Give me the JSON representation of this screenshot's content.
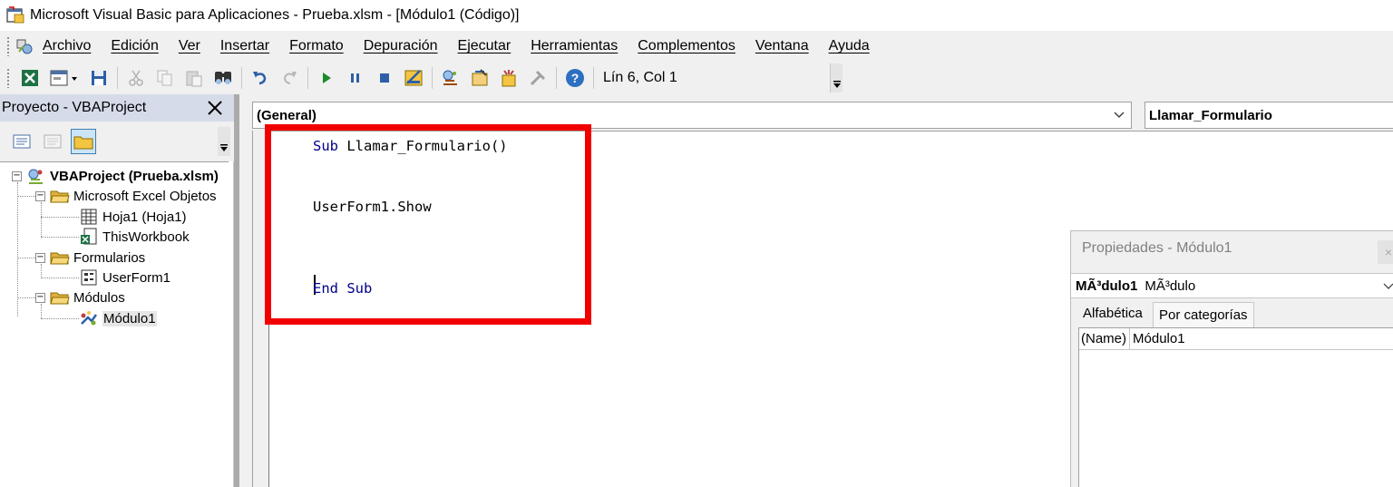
{
  "window": {
    "title": "Microsoft Visual Basic para Aplicaciones - Prueba.xlsm - [Módulo1 (Código)]",
    "icon": "vba-window-icon"
  },
  "menu": {
    "items": [
      "Archivo",
      "Edición",
      "Ver",
      "Insertar",
      "Formato",
      "Depuración",
      "Ejecutar",
      "Herramientas",
      "Complementos",
      "Ventana",
      "Ayuda"
    ]
  },
  "toolbar": {
    "position_label": "Lín 6, Col 1",
    "icons": [
      "excel-icon",
      "insert-userform-icon",
      "save-icon",
      "cut-icon",
      "copy-icon",
      "paste-icon",
      "find-icon",
      "undo-icon",
      "redo-icon",
      "run-icon",
      "break-icon",
      "reset-icon",
      "design-mode-icon",
      "project-explorer-icon",
      "properties-icon",
      "object-browser-icon",
      "toolbox-icon",
      "help-icon"
    ]
  },
  "project_panel": {
    "title": "Proyecto - VBAProject",
    "close": "✕",
    "tree": {
      "root": "VBAProject (Prueba.xlsm)",
      "excel_objects": "Microsoft Excel Objetos",
      "sheet1": "Hoja1 (Hoja1)",
      "workbook": "ThisWorkbook",
      "forms": "Formularios",
      "userform": "UserForm1",
      "modules": "Módulos",
      "module1": "Módulo1"
    }
  },
  "code_window": {
    "object_combo": "(General)",
    "procedure_combo": "Llamar_Formulario",
    "lines": {
      "line1_kw": "Sub",
      "line1_rest": " Llamar_Formulario()",
      "line4": "UserForm1.Show",
      "line8": "End Sub"
    }
  },
  "properties_panel": {
    "title": "Propiedades - Módulo1",
    "close": "×",
    "object_name": "MÃ³dulo1",
    "object_type": "MÃ³dulo",
    "tabs": [
      "Alfabética",
      "Por categorías"
    ],
    "rows": [
      {
        "name": "(Name)",
        "value": "Módulo1"
      }
    ]
  },
  "colors": {
    "highlight": "#f20000",
    "keyword": "#00008b",
    "panel_header": "#d6dbe9"
  }
}
